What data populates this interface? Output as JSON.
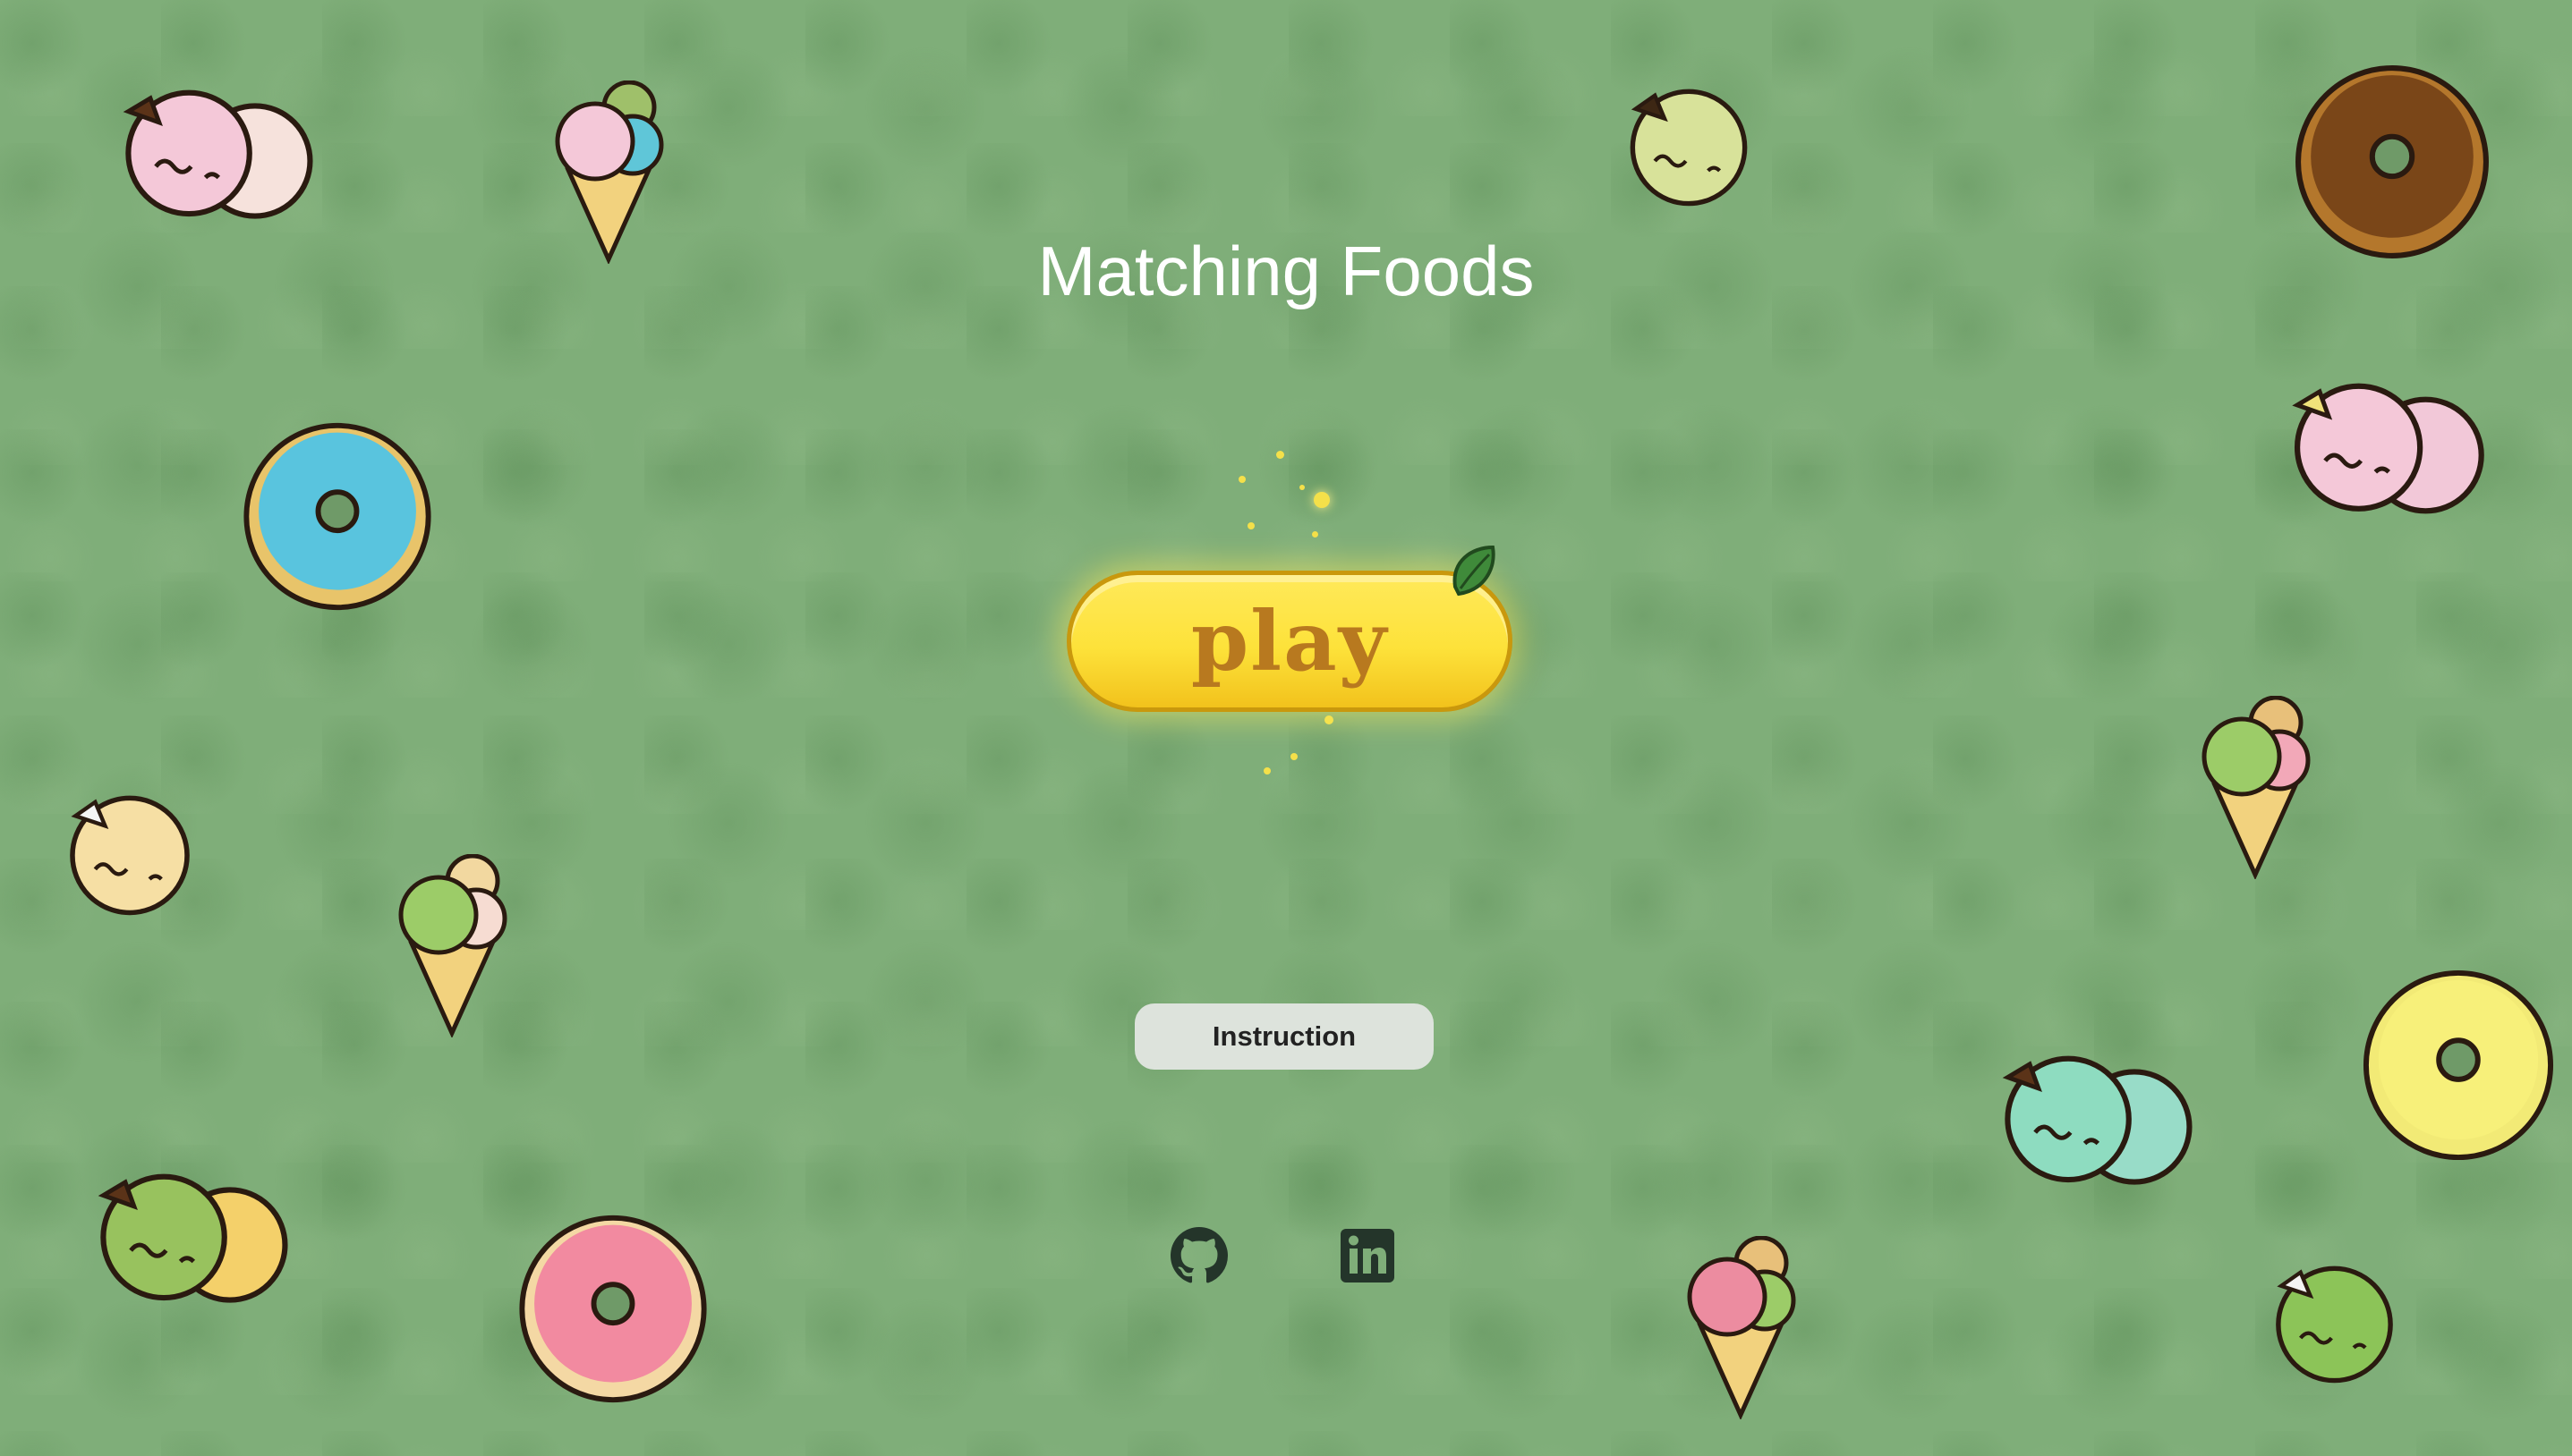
{
  "title": "Matching Foods",
  "play_label": "play",
  "instruction_label": "Instruction",
  "links": [
    {
      "name": "github",
      "icon": "github-icon"
    },
    {
      "name": "linkedin",
      "icon": "linkedin-icon"
    }
  ],
  "colors": {
    "background": "#7fae79",
    "play_button": "#fde23a",
    "play_text": "#b8791f",
    "instruction_button": "#dde3dc",
    "social_icon": "#24352a"
  }
}
